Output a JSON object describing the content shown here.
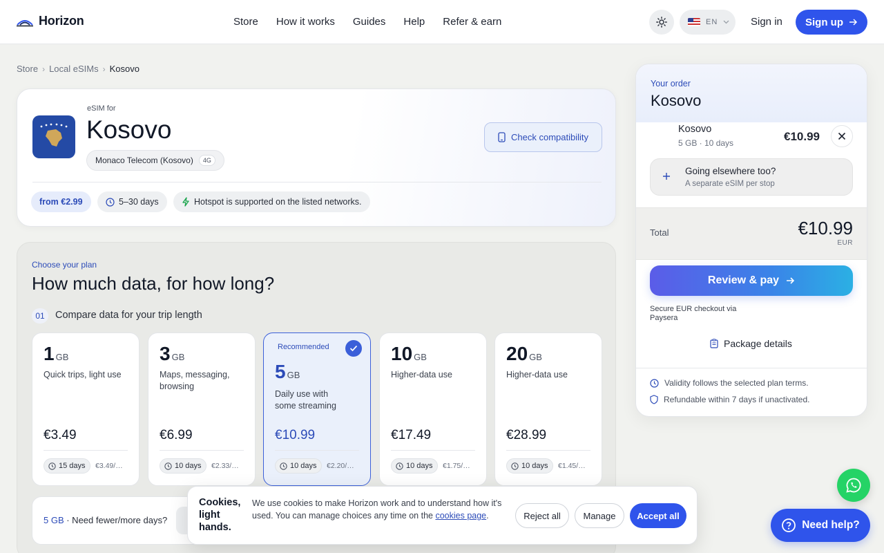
{
  "header": {
    "brand": "Horizon",
    "nav": [
      "Store",
      "How it works",
      "Guides",
      "Help",
      "Refer & earn"
    ],
    "lang": "EN",
    "sign_in": "Sign in",
    "sign_up": "Sign up"
  },
  "breadcrumb": [
    "Store",
    "Local eSIMs",
    "Kosovo"
  ],
  "country": {
    "esim_for": "eSIM for",
    "name": "Kosovo",
    "operator": "Monaco Telecom (Kosovo)",
    "network": "4G",
    "check_label": "Check compatibility",
    "chips": {
      "price": "from €2.99",
      "days": "5–30 days",
      "hotspot": "Hotspot is supported on the listed networks."
    }
  },
  "plans": {
    "kicker": "Choose your plan",
    "title": "How much data, for how long?",
    "step_num": "01",
    "step_text": "Compare data for your trip length",
    "recommended": "Recommended",
    "items": [
      {
        "size": "1",
        "unit": "GB",
        "desc": "Quick trips, light use",
        "price": "€3.49",
        "days": "15 days",
        "per": "€3.49/…",
        "selected": false
      },
      {
        "size": "3",
        "unit": "GB",
        "desc": "Maps, messaging, browsing",
        "price": "€6.99",
        "days": "10 days",
        "per": "€2.33/…",
        "selected": false
      },
      {
        "size": "5",
        "unit": "GB",
        "desc": "Daily use with some streaming",
        "price": "€10.99",
        "days": "10 days",
        "per": "€2.20/…",
        "selected": true
      },
      {
        "size": "10",
        "unit": "GB",
        "desc": "Higher-data use",
        "price": "€17.49",
        "days": "10 days",
        "per": "€1.75/…",
        "selected": false
      },
      {
        "size": "20",
        "unit": "GB",
        "desc": "Higher-data use",
        "price": "€28.99",
        "days": "10 days",
        "per": "€1.45/…",
        "selected": false
      }
    ],
    "fewer_prefix": "5 GB",
    "fewer_text": " · Need fewer/more days?"
  },
  "order": {
    "kicker": "Your order",
    "country": "Kosovo",
    "item_name": "Kosovo",
    "item_meta": "5 GB · 10 days",
    "item_price": "€10.99",
    "elsewhere_title": "Going elsewhere too?",
    "elsewhere_sub": "A separate eSIM per stop",
    "total_label": "Total",
    "total_amount": "€10.99",
    "total_currency": "EUR",
    "pay_label": "Review & pay",
    "secure_text": "Secure EUR checkout via Paysera",
    "package_details": "Package details",
    "note_validity": "Validity follows the selected plan terms.",
    "note_refund": "Refundable within 7 days if unactivated."
  },
  "cookie": {
    "title": "Cookies, light hands.",
    "text": "We use cookies to make Horizon work and to understand how it's used. You can manage choices any time on the ",
    "link": "cookies page",
    "text_end": ".",
    "reject": "Reject all",
    "manage": "Manage",
    "accept": "Accept all"
  },
  "help_label": "Need help?",
  "colors": {
    "accent": "#2f54eb",
    "accent_text": "#2c4bb8",
    "whatsapp": "#25d366",
    "flag_blue": "#244aa5",
    "flag_gold": "#d0a75a"
  }
}
